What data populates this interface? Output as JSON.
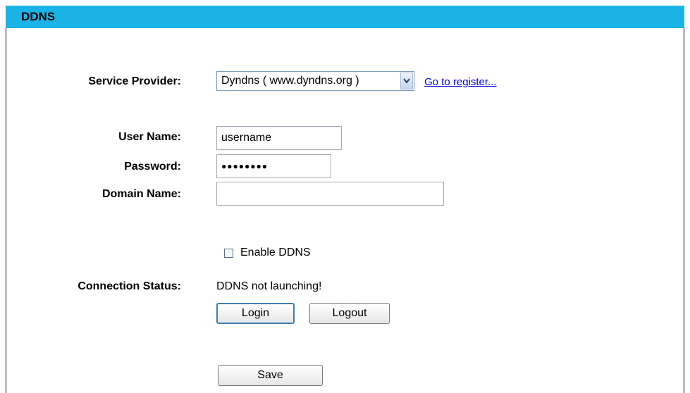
{
  "header": {
    "title": "DDNS"
  },
  "form": {
    "service_provider_label": "Service Provider:",
    "service_provider_value": "Dyndns ( www.dyndns.org )",
    "register_link": "Go to register...",
    "username_label": "User Name:",
    "username_value": "username",
    "password_label": "Password:",
    "password_value": "●●●●●●●●",
    "domain_label": "Domain Name:",
    "domain_value": "",
    "enable_label": "Enable DDNS",
    "enable_checked": false,
    "status_label": "Connection Status:",
    "status_value": "DDNS not launching!"
  },
  "buttons": {
    "login": "Login",
    "logout": "Logout",
    "save": "Save"
  },
  "colors": {
    "header_bg": "#1ab3e6",
    "link": "#0000ee"
  },
  "icons": {
    "select_arrow": "chevron-down-icon"
  }
}
